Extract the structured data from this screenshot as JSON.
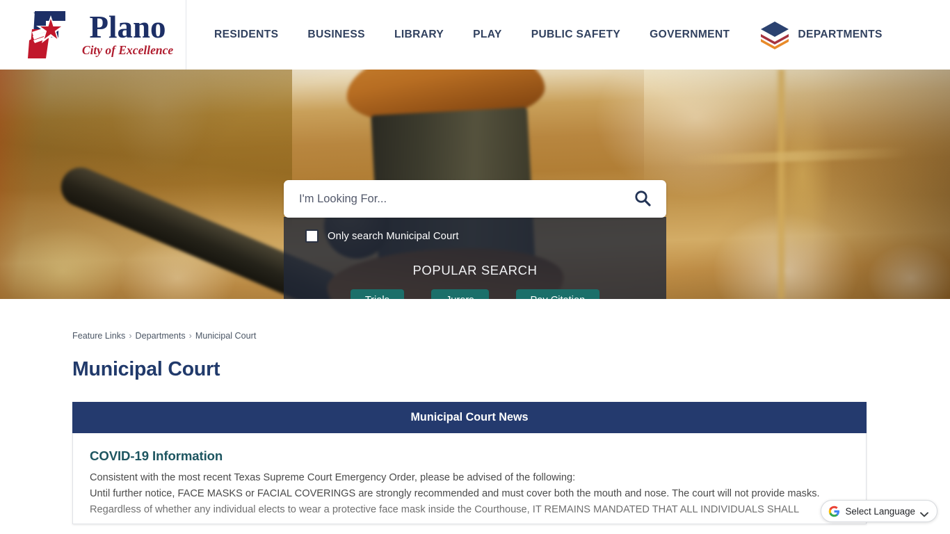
{
  "header": {
    "logo": {
      "word": "Plano",
      "tagline": "City of Excellence",
      "emblem_name": "plano-star-p-emblem"
    },
    "nav": [
      {
        "label": "RESIDENTS"
      },
      {
        "label": "BUSINESS"
      },
      {
        "label": "LIBRARY"
      },
      {
        "label": "PLAY"
      },
      {
        "label": "PUBLIC SAFETY"
      },
      {
        "label": "GOVERNMENT"
      }
    ],
    "departments": {
      "label": "DEPARTMENTS",
      "icon": "layers-stack-icon",
      "icon_colors": [
        "#2b4270",
        "#a6333f",
        "#e88a2a"
      ]
    }
  },
  "hero": {
    "image_description": "blurred courtroom gavel and scales of justice",
    "search": {
      "placeholder": "I'm Looking For...",
      "value": "",
      "search_icon": "search-icon"
    },
    "only_search": {
      "label": "Only search Municipal Court",
      "checked": false
    },
    "popular_search": {
      "title": "POPULAR SEARCH",
      "buttons": [
        {
          "label": "Trials"
        },
        {
          "label": "Jurors"
        },
        {
          "label": "Pay Citation"
        }
      ],
      "button_color": "#1b6f6a"
    }
  },
  "breadcrumb": {
    "items": [
      {
        "label": "Feature Links"
      },
      {
        "label": "Departments"
      },
      {
        "label": "Municipal Court"
      }
    ],
    "separator": "›"
  },
  "page": {
    "title": "Municipal Court"
  },
  "news": {
    "header": "Municipal Court News",
    "header_color": "#243a6e",
    "heading": "COVID-19 Information",
    "heading_color": "#1d5560",
    "paragraphs": [
      "Consistent with the most recent Texas Supreme Court Emergency Order, please be advised of the following:",
      "Until further notice, FACE MASKS or FACIAL COVERINGS are strongly recommended and must cover both the mouth and nose. The court will not provide masks.",
      "Regardless of whether any individual elects to wear a protective face mask inside the Courthouse, IT REMAINS MANDATED THAT ALL INDIVIDUALS SHALL"
    ]
  },
  "translate_widget": {
    "label": "Select Language",
    "icon": "google-g-icon",
    "chevron": "chevron-down-icon"
  }
}
